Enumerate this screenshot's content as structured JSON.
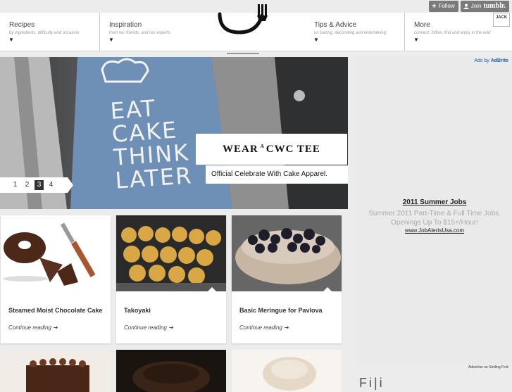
{
  "tumblr": {
    "follow_label": "Follow",
    "join_label": "Join",
    "join_brand": "tumblr."
  },
  "nav": {
    "items": [
      {
        "title": "Recipes",
        "subtitle": "by ingredients, difficulty and occasion",
        "arrow": "▼"
      },
      {
        "title": "Inspiration",
        "subtitle": "from our friends, and our experts",
        "arrow": "▼"
      },
      {
        "title": "Tips & Advice",
        "subtitle": "on baking, decorating and entertaining",
        "arrow": "▼"
      },
      {
        "title": "More",
        "subtitle": "connect, follow, find and enjoy in the wild",
        "arrow": "▼"
      }
    ]
  },
  "badge": "JACK",
  "hero": {
    "shirt_lines": [
      "EAT",
      "CAKE",
      "THINK",
      "LATER"
    ],
    "headline_left": "WEAR",
    "headline_sup": "A",
    "headline_right": "CWC TEE",
    "subline": "Official Celebrate With Cake Apparel.",
    "pages": [
      "1",
      "2",
      "3",
      "4"
    ],
    "active_page": "3"
  },
  "ads": {
    "ads_by": "Ads by",
    "ads_brand": "AdBrite",
    "title": "2011 Summer Jobs",
    "body": "Summer 2011 Part-Time & Full Time Jobs. Openings Up To $15+/Hour!",
    "link": "www.JobAlertsUsa.com",
    "advertise": "Advertise on Smiling Fork",
    "partial_heading": "Fi|i"
  },
  "cards": [
    {
      "title": "Steamed Moist Chocolate Cake",
      "more": "Continue reading ➔"
    },
    {
      "title": "Takoyaki",
      "more": "Continue reading ➔"
    },
    {
      "title": "Basic Meringue for Pavlova",
      "more": "Continue reading ➔"
    }
  ],
  "colors": {
    "page_bg": "#ececec",
    "ads_link": "#1b5fb3",
    "hero_shirt": "#6e8fb6"
  }
}
